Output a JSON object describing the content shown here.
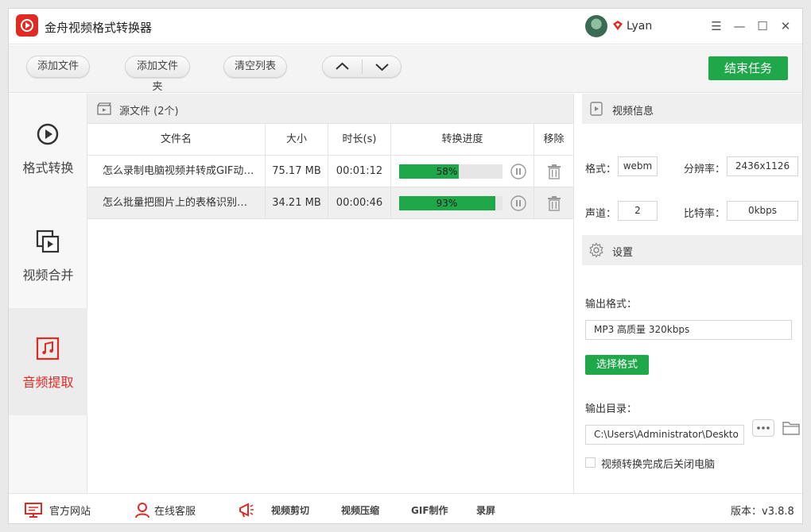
{
  "app": {
    "title": "金舟视频格式转换器",
    "username": "Lyan",
    "accent_color": "#e02b24",
    "green_color": "#1fa84a"
  },
  "window_controls": {
    "menu": "☰",
    "minimize": "—",
    "maximize": "☐",
    "close": "✕"
  },
  "toolbar": {
    "add_file": "添加文件",
    "add_folder": "添加文件夹",
    "clear_list": "清空列表",
    "finish_task": "结束任务"
  },
  "sidenav": {
    "items": [
      {
        "label": "格式转换",
        "icon": "convert-icon",
        "active": false
      },
      {
        "label": "视频合并",
        "icon": "merge-icon",
        "active": false
      },
      {
        "label": "音频提取",
        "icon": "music-note-icon",
        "active": true
      }
    ]
  },
  "filelist": {
    "source_title": "源文件 (2个)",
    "columns": [
      "文件名",
      "大小",
      "时长(s)",
      "转换进度",
      "移除"
    ],
    "rows": [
      {
        "name": "怎么录制电脑视频并转成GIF动…",
        "size": "75.17 MB",
        "duration": "00:01:12",
        "progress": 58,
        "progress_label": "58%"
      },
      {
        "name": "怎么批量把图片上的表格识别…",
        "size": "34.21 MB",
        "duration": "00:00:46",
        "progress": 93,
        "progress_label": "93%"
      }
    ]
  },
  "video_info": {
    "title": "视频信息",
    "format_label": "格式：",
    "format_value": "webm",
    "resolution_label": "分辨率：",
    "resolution_value": "2436x1126",
    "channels_label": "声道：",
    "channels_value": "2",
    "bitrate_label": "比特率：",
    "bitrate_value": "0kbps"
  },
  "settings": {
    "title": "设置",
    "output_format_label": "输出格式：",
    "output_format_value": "MP3 高质量 320kbps",
    "choose_format": "选择格式",
    "output_dir_label": "输出目录：",
    "output_dir_value": "C:\\Users\\Administrator\\Deskto",
    "shutdown_label": "视频转换完成后关闭电脑",
    "shutdown_checked": false
  },
  "statusbar": {
    "website": "官方网站",
    "support": "在线客服",
    "video_cut": "视频剪切",
    "video_compress": "视频压缩",
    "gif_make": "GIF制作",
    "record": "录屏",
    "version": "版本：v3.8.8"
  }
}
